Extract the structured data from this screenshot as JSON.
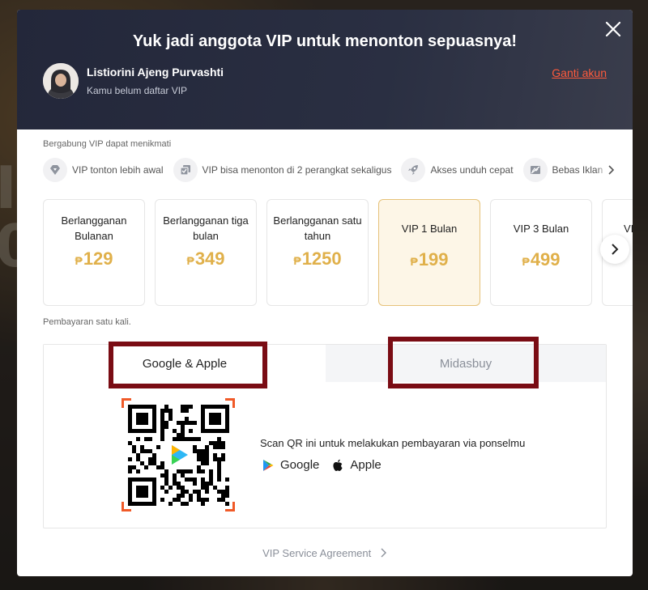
{
  "header": {
    "title": "Yuk jadi anggota VIP untuk menonton sepuasnya!",
    "user_name": "Listiorini Ajeng Purvashti",
    "user_status": "Kamu belum daftar VIP",
    "switch_account": "Ganti akun"
  },
  "benefits": {
    "title": "Bergabung VIP dapat menikmati",
    "items": [
      {
        "label": "VIP tonton lebih awal",
        "icon": "diamond-icon"
      },
      {
        "label": "VIP bisa menonton di 2 perangkat sekaligus",
        "icon": "devices-icon"
      },
      {
        "label": "Akses unduh cepat",
        "icon": "rocket-icon"
      },
      {
        "label": "Bebas Iklan",
        "icon": "no-ads-icon"
      }
    ]
  },
  "plans": [
    {
      "name": "Berlangganan Bulanan",
      "currency": "₱",
      "price": "129",
      "selected": false
    },
    {
      "name": "Berlangganan tiga bulan",
      "currency": "₱",
      "price": "349",
      "selected": false
    },
    {
      "name": "Berlangganan satu tahun",
      "currency": "₱",
      "price": "1250",
      "selected": false
    },
    {
      "name": "VIP 1 Bulan",
      "currency": "₱",
      "price": "199",
      "selected": true
    },
    {
      "name": "VIP 3 Bulan",
      "currency": "₱",
      "price": "499",
      "selected": false
    },
    {
      "name": "VI",
      "currency": "",
      "price": "",
      "selected": false
    }
  ],
  "payment": {
    "note": "Pembayaran satu kali.",
    "tabs": [
      {
        "label": "Google & Apple",
        "active": true
      },
      {
        "label": "Midasbuy",
        "active": false
      }
    ],
    "scan_text": "Scan QR ini untuk melakukan pembayaran via ponselmu",
    "stores": [
      {
        "label": "Google",
        "icon": "google-play-icon"
      },
      {
        "label": "Apple",
        "icon": "apple-icon"
      }
    ]
  },
  "footer": {
    "agreement": "VIP Service Agreement"
  },
  "colors": {
    "accent_price": "#e0b04a",
    "link": "#ff5a3c",
    "highlight_box": "#7a0c14",
    "header_bg": "#23273a"
  }
}
